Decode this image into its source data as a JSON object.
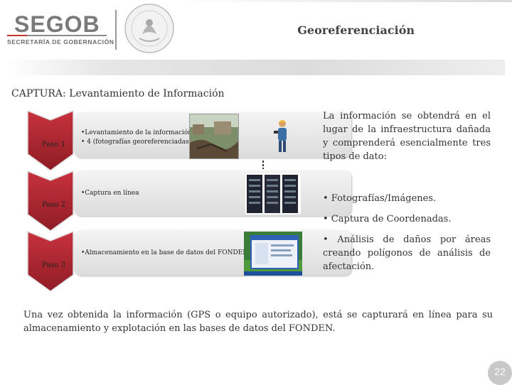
{
  "header": {
    "logo_text": "SEGOB",
    "logo_subtitle": "SECRETARÍA DE GOBERNACIÓN",
    "title": "Georeferenciación"
  },
  "capture_title": "CAPTURA: Levantamiento de Información",
  "steps": [
    {
      "label": "Paso 1",
      "bullets": [
        "•Levantamiento de la información",
        "• 4 (fotografías georeferenciadas)"
      ]
    },
    {
      "label": "Paso 2",
      "bullets": [
        "•Captura en línea"
      ]
    },
    {
      "label": "Paso 3",
      "bullets": [
        "•Almacenamiento en la base de datos del FONDEN"
      ]
    }
  ],
  "info_paragraph": "La información se obtendrá en el lugar de la infraestructura dañada y comprenderá esencialmente tres tipos de dato:",
  "data_types": [
    "•  Fotografías/Imágenes.",
    "•  Captura de Coordenadas.",
    "•  Análisis de daños por áreas creando polígonos de análisis de afectación."
  ],
  "footer_paragraph": "Una vez obtenida la información (GPS o equipo autorizado), está se capturará en línea para su almacenamiento y explotación en las bases de datos del FONDEN.",
  "page_number": "22",
  "colors": {
    "chevron": "#b22a34",
    "chevron_dark": "#8e1c25"
  }
}
